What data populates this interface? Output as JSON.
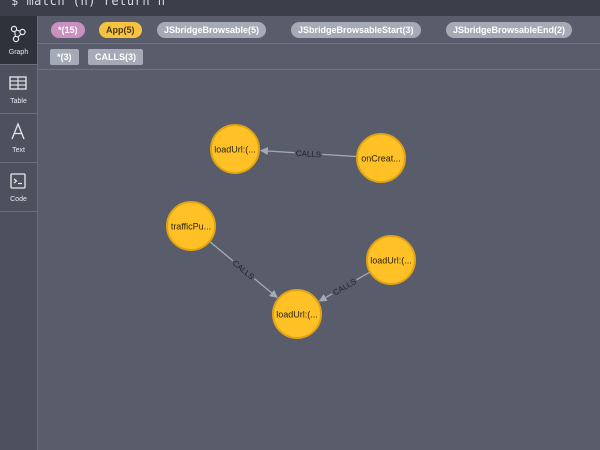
{
  "query": {
    "text": "$ match (n) return n"
  },
  "sidebar": {
    "items": [
      {
        "label": "Graph",
        "icon": "graph-icon"
      },
      {
        "label": "Table",
        "icon": "table-icon"
      },
      {
        "label": "Text",
        "icon": "text-icon"
      },
      {
        "label": "Code",
        "icon": "code-icon"
      }
    ]
  },
  "labels_row": [
    {
      "label": "*(15)",
      "color": "#c990c0",
      "text_color": "#ffffff"
    },
    {
      "label": "App(5)",
      "color": "#f6c242",
      "text_color": "#4a3a10"
    },
    {
      "label": "JSbridgeBrowsable(5)",
      "color": "#a5abb6",
      "text_color": "#ffffff"
    },
    {
      "label": "JSbridgeBrowsableStart(3)",
      "color": "#a5abb6",
      "text_color": "#ffffff"
    },
    {
      "label": "JSbridgeBrowsableEnd(2)",
      "color": "#a5abb6",
      "text_color": "#ffffff"
    }
  ],
  "rel_row": [
    {
      "label": "*(3)",
      "color": "#a5abb6"
    },
    {
      "label": "CALLS(3)",
      "color": "#a5abb6"
    }
  ],
  "graph": {
    "node_color": "#ffc125",
    "node_border": "#e0a313",
    "nodes": [
      {
        "id": "n1",
        "label": "loadUrl:(..."
      },
      {
        "id": "n2",
        "label": "onCreat..."
      },
      {
        "id": "n3",
        "label": "trafficPu..."
      },
      {
        "id": "n4",
        "label": "loadUrl:(..."
      },
      {
        "id": "n5",
        "label": "loadUrl:(..."
      }
    ],
    "edges": [
      {
        "from": "n2",
        "to": "n1",
        "label": "CALLS"
      },
      {
        "from": "n3",
        "to": "n5",
        "label": "CALLS"
      },
      {
        "from": "n4",
        "to": "n5",
        "label": "CALLS"
      }
    ]
  }
}
